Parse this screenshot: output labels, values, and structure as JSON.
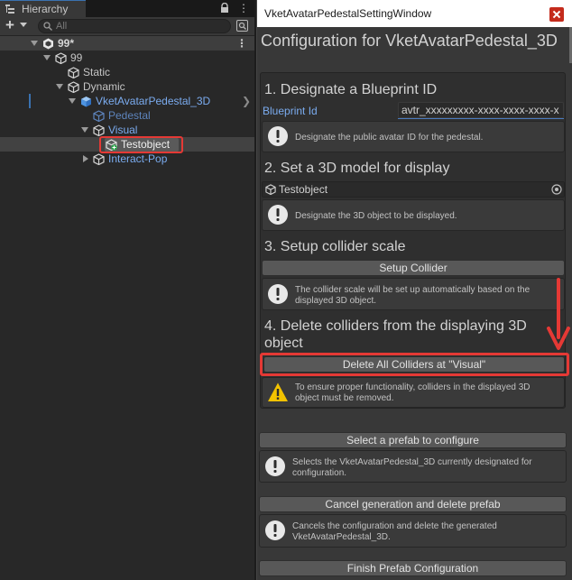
{
  "hierarchy": {
    "tab_label": "Hierarchy",
    "menu_glyph": "⋮",
    "add_glyph": "+",
    "search_placeholder": "All",
    "tree": {
      "scene": "99*",
      "root": "99",
      "static": "Static",
      "dynamic": "Dynamic",
      "avatar_pedestal": "VketAvatarPedestal_3D",
      "pedestal": "Pedestal",
      "visual": "Visual",
      "testobject": "Testobject",
      "interact_pop": "Interact-Pop"
    },
    "icons": {
      "tab": "hierarchy-icon",
      "lock": "lock-icon",
      "search": "search-icon",
      "filter": "filter-icon",
      "scene": "unity-scene-icon",
      "gameobject": "gameobject-cube-icon",
      "prefab": "prefab-cube-icon"
    }
  },
  "window": {
    "title": "VketAvatarPedestalSettingWindow",
    "heading": "Configuration for VketAvatarPedestal_3D",
    "step1": {
      "heading": "1. Designate a Blueprint ID",
      "label": "Blueprint Id",
      "value": "avtr_xxxxxxxxx-xxxx-xxxx-xxxx-x",
      "help": "Designate the public avatar ID for the pedestal."
    },
    "step2": {
      "heading": "2. Set a 3D model for display",
      "object_value": "Testobject",
      "help": "Designate the 3D object to be displayed."
    },
    "step3": {
      "heading": "3. Setup collider scale",
      "button": "Setup Collider",
      "help_line1": "The collider scale will be set up automatically based on the",
      "help_line2": "displayed 3D object."
    },
    "step4": {
      "heading_line1": "4. Delete colliders from the displaying 3D",
      "heading_line2": "object",
      "button": "Delete All Colliders at \"Visual\"",
      "help_line1": "To ensure proper functionality, colliders in the displayed 3D",
      "help_line2": "object must be removed."
    },
    "select_prefab": {
      "button": "Select a prefab to configure",
      "help_line1": "Selects the VketAvatarPedestal_3D currently designated for",
      "help_line2": "configuration."
    },
    "cancel": {
      "button": "Cancel generation and delete prefab",
      "help_line1": "Cancels the configuration and delete the generated",
      "help_line2": "VketAvatarPedestal_3D."
    },
    "finish": {
      "button": "Finish Prefab Configuration"
    }
  },
  "colors": {
    "highlight_red": "#e53935",
    "prefab_blue": "#7bacf0",
    "accent_blue": "#3a72b0",
    "warning_yellow": "#f2c200"
  }
}
